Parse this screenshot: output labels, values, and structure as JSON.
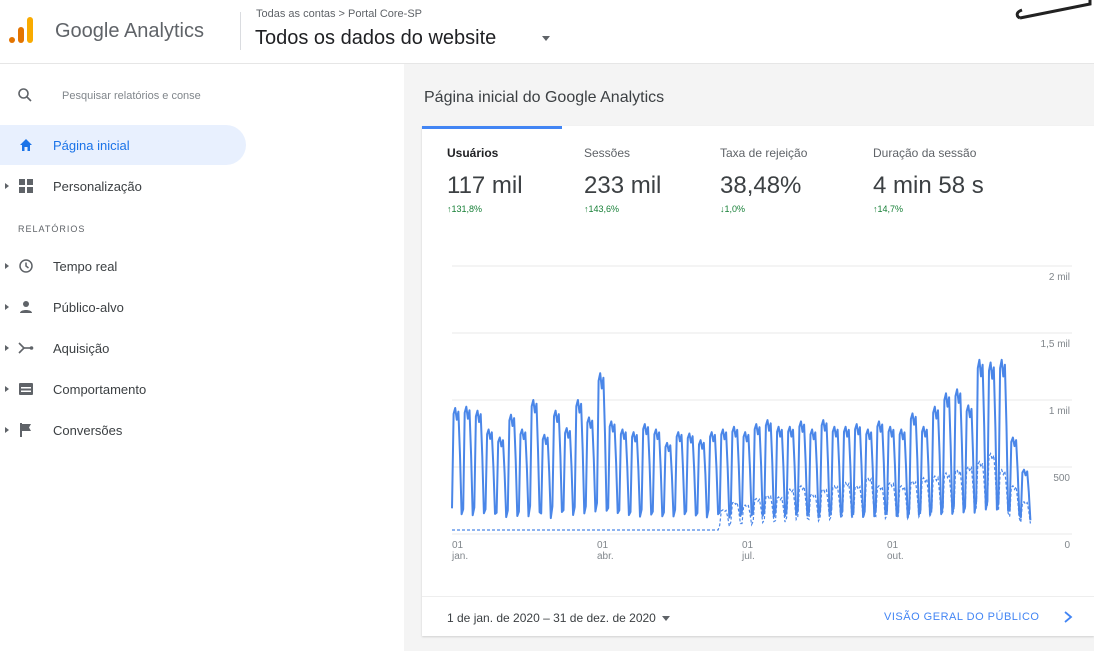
{
  "app": {
    "brand": "Google Analytics",
    "breadcrumb": "Todas as contas > Portal Core-SP",
    "view_title": "Todos os dados do website"
  },
  "sidebar": {
    "search_placeholder": "Pesquisar relatórios e conse",
    "home_label": "Página inicial",
    "customization_label": "Personalização",
    "section_title": "RELATÓRIOS",
    "reports": [
      {
        "label": "Tempo real",
        "icon": "clock-icon"
      },
      {
        "label": "Público-alvo",
        "icon": "person-icon"
      },
      {
        "label": "Aquisição",
        "icon": "acquisition-icon"
      },
      {
        "label": "Comportamento",
        "icon": "behavior-icon"
      },
      {
        "label": "Conversões",
        "icon": "flag-icon"
      }
    ]
  },
  "main": {
    "title": "Página inicial do Google Analytics",
    "metrics": [
      {
        "label": "Usuários",
        "value": "117 mil",
        "delta": "↑131,8%"
      },
      {
        "label": "Sessões",
        "value": "233 mil",
        "delta": "↑143,6%"
      },
      {
        "label": "Taxa de rejeição",
        "value": "38,48%",
        "delta": "↓1,0%"
      },
      {
        "label": "Duração da sessão",
        "value": "4 min 58 s",
        "delta": "↑14,7%"
      }
    ],
    "footer": {
      "date_range": "1 de jan. de 2020 – 31 de dez. de 2020",
      "overview_link": "VISÃO GERAL DO PÚBLICO"
    }
  },
  "colors": {
    "accent": "#4285f4",
    "positive": "#188038",
    "line": "#4a86e8"
  },
  "chart_data": {
    "type": "line",
    "y_ticks": [
      "2 mil",
      "1,5 mil",
      "1 mil",
      "500",
      "0"
    ],
    "y_tick_values": [
      2000,
      1500,
      1000,
      500,
      0
    ],
    "ylim": [
      0,
      2000
    ],
    "x_ticks": [
      {
        "day": "01",
        "month": "jan."
      },
      {
        "day": "01",
        "month": "abr."
      },
      {
        "day": "01",
        "month": "jul."
      },
      {
        "day": "01",
        "month": "out."
      }
    ],
    "x_tick_week": [
      0,
      13,
      26,
      39
    ],
    "series": [
      {
        "style": "solid",
        "weekly_peaks": [
          940,
          950,
          920,
          780,
          720,
          890,
          780,
          1000,
          740,
          920,
          790,
          1000,
          870,
          1200,
          840,
          780,
          760,
          820,
          780,
          680,
          760,
          750,
          700,
          760,
          780,
          800,
          760,
          820,
          850,
          800,
          800,
          840,
          780,
          850,
          800,
          800,
          820,
          780,
          840,
          800,
          780,
          900,
          800,
          950,
          1050,
          1080,
          960,
          1300,
          1280,
          1300,
          720,
          480
        ],
        "weekly_troughs": [
          60,
          50,
          70,
          80,
          60,
          50,
          60,
          70,
          50,
          80,
          70,
          60,
          90,
          60,
          80,
          70,
          60,
          70,
          60,
          70,
          80,
          70,
          60,
          80,
          50,
          60,
          70,
          60,
          50,
          60,
          70,
          60,
          50,
          60,
          70,
          60,
          50,
          60,
          70,
          60,
          50,
          60,
          70,
          60,
          50,
          60,
          70,
          60,
          60,
          50,
          80,
          60
        ]
      },
      {
        "style": "dashed",
        "weekly_levels": [
          30,
          30,
          30,
          30,
          30,
          30,
          30,
          30,
          30,
          30,
          30,
          30,
          30,
          30,
          30,
          30,
          30,
          30,
          30,
          30,
          30,
          30,
          30,
          30,
          150,
          200,
          180,
          220,
          240,
          230,
          280,
          300,
          250,
          280,
          300,
          320,
          300,
          350,
          300,
          320,
          300,
          330,
          350,
          360,
          380,
          400,
          420,
          450,
          500,
          400,
          300,
          200
        ]
      }
    ]
  }
}
